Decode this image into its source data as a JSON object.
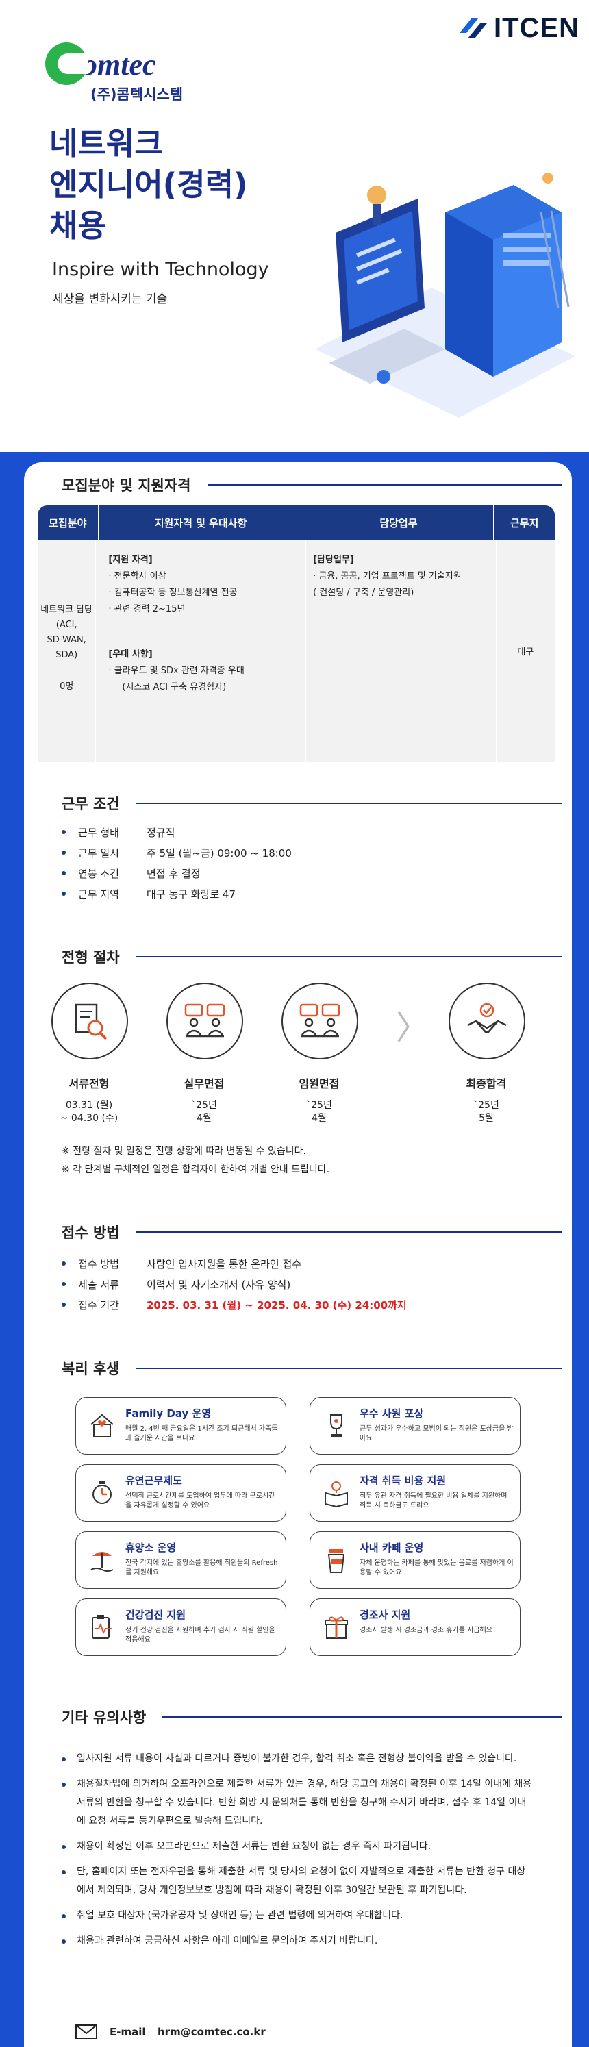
{
  "header": {
    "itcen_logo": "ITCEN",
    "comtec_logo": "omtec",
    "comtec_name": "(주)콤텍시스템"
  },
  "hero": {
    "title_line1": "네트워크",
    "title_line2": "엔지니어(경력)",
    "title_line3": "채용",
    "tagline": "Inspire with Technology",
    "subtagline": "세상을 변화시키는 기술"
  },
  "recruit": {
    "heading": "모집분야 및 지원자격",
    "columns": [
      "모집분야",
      "지원자격 및 우대사항",
      "담당업무",
      "근무지"
    ],
    "field_lines": [
      "네트워크 담당",
      "(ACI,",
      "SD-WAN,",
      "SDA)"
    ],
    "headcount": "0명",
    "qual_heading": "[지원 자격]",
    "qual_items": [
      "· 전문학사 이상",
      "· 컴퓨터공학 등 정보통신계열 전공",
      "· 관련 경력 2~15년"
    ],
    "pref_heading": "[우대 사항]",
    "pref_items": [
      "· 클라우드 및 SDx 관련 자격증 우대",
      "(시스코 ACI 구축 유경험자)"
    ],
    "duty_heading": "[담당업무]",
    "duty_items": [
      "· 금융, 공공, 기업 프로젝트 및 기술지원",
      "( 컨설팅 / 구축 / 운영관리)"
    ],
    "location": "대구"
  },
  "conditions": {
    "heading": "근무 조건",
    "rows": [
      {
        "k": "근무 형태",
        "v": "정규직"
      },
      {
        "k": "근무 일시",
        "v": "주 5일 (월~금) 09:00 ~ 18:00"
      },
      {
        "k": "연봉 조건",
        "v": "면접 후 결정"
      },
      {
        "k": "근무 지역",
        "v": "대구 동구 화랑로 47"
      }
    ]
  },
  "process": {
    "heading": "전형 절차",
    "steps": [
      {
        "name": "서류전형",
        "date1": "03.31 (월)",
        "date2": "~ 04.30 (수)",
        "icon": "document-search-icon"
      },
      {
        "name": "실무면접",
        "date1": "`25년",
        "date2": "4월",
        "icon": "interview-icon"
      },
      {
        "name": "임원면접",
        "date1": "`25년",
        "date2": "4월",
        "icon": "executive-interview-icon"
      },
      {
        "name": "최종합격",
        "date1": "`25년",
        "date2": "5월",
        "icon": "handshake-icon"
      }
    ],
    "arrow": "〉",
    "notes": [
      "※ 전형 절차 및 일정은 진행 상황에 따라 변동될 수 있습니다.",
      "※ 각 단계별 구체적인 일정은 합격자에 한하여 개별 안내 드립니다."
    ]
  },
  "apply": {
    "heading": "접수 방법",
    "rows": [
      {
        "k": "접수 방법",
        "v": "사람인 입사지원을 통한 온라인 접수"
      },
      {
        "k": "제출 서류",
        "v": "이력서 및 자기소개서 (자유 양식)"
      },
      {
        "k": "접수 기간",
        "v": "2025. 03. 31 (월) ~ 2025. 04. 30 (수) 24:00까지"
      }
    ]
  },
  "benefits": {
    "heading": "복리 후생",
    "items": [
      {
        "t": "Family Day 운영",
        "d": "매월 2, 4번 째 금요일은 1시간 조기 퇴근해서 가족들과 즐거운 시간을 보내요",
        "icon": "family-icon"
      },
      {
        "t": "우수 사원 포상",
        "d": "근무 성과가 우수하고 모범이 되는 직원은 포상금을 받아요",
        "icon": "trophy-icon"
      },
      {
        "t": "유연근무제도",
        "d": "선택적 근로시간제를 도입하여 업무에 따라 근로시간을 자유롭게 설정할 수 있어요",
        "icon": "stopwatch-icon"
      },
      {
        "t": "자격 취득 비용 지원",
        "d": "직무 유관 자격 취득에 필요한 비용 일체를 지원하며 취득 시 축하금도 드려요",
        "icon": "book-idea-icon"
      },
      {
        "t": "휴양소 운영",
        "d": "전국 각지에 있는 휴양소를 활용해 직원들의 Refresh를 지원해요",
        "icon": "resort-icon"
      },
      {
        "t": "사내 카페 운영",
        "d": "자체 운영하는 카페를 통해 맛있는 음료를 저렴하게 이용할 수 있어요",
        "icon": "coffee-icon"
      },
      {
        "t": "건강검진 지원",
        "d": "정기 건강 검진을 지원하며 추가 검사 시 직원 할인을 적용해요",
        "icon": "health-check-icon"
      },
      {
        "t": "경조사 지원",
        "d": "경조사 발생 시 경조금과 경조 휴가를 지급해요",
        "icon": "gift-icon"
      }
    ]
  },
  "etc": {
    "heading": "기타 유의사항",
    "items": [
      "입사지원 서류 내용이 사실과 다르거나 증빙이 불가한 경우, 합격 취소 혹은 전형상 불이익을 받을 수 있습니다.",
      "채용절차법에 의거하여 오프라인으로 제출한 서류가 있는 경우, 해당 공고의 채용이 확정된 이후 14일 이내에 채용서류의 반환을 청구할 수 있습니다. 반환 희망 시 문의처를 통해 반환을 청구해 주시기 바라며, 접수 후 14일 이내에 요청 서류를 등기우편으로 발송해 드립니다.",
      "채용이 확정된 이후 오프라인으로 제출한 서류는 반환 요청이 없는 경우 즉시 파기됩니다.",
      "단, 홈페이지 또는 전자우편을 통해 제출한 서류 및 당사의 요청이 없이 자발적으로 제출한 서류는 반환 청구 대상에서 제외되며, 당사 개인정보보호 방침에 따라 채용이 확정된 이후 30일간 보관된 후 파기됩니다.",
      "취업 보호 대상자 (국가유공자 및 장애인 등) 는 관련 법령에 의거하여 우대합니다.",
      "채용과 관련하여 궁금하신 사항은 아래 이메일로 문의하여 주시기 바랍니다."
    ],
    "email_label": "E-mail",
    "email": "hrm@comtec.co.kr"
  }
}
